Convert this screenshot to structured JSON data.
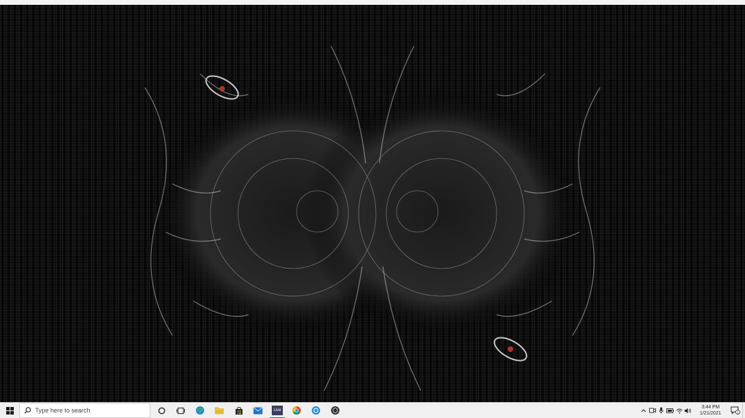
{
  "desktop": {
    "wallpaper_icon": "abstract-wallpaper",
    "colors": {
      "background": "#000000",
      "taskbar": "#f0f0f0",
      "accent": "#0078d7"
    }
  },
  "taskbar": {
    "start_icon": "windows-logo-icon",
    "search": {
      "placeholder": "Type here to search",
      "icon": "search-icon"
    },
    "pinned": [
      {
        "name": "cortana",
        "icon": "circle-icon",
        "active": false
      },
      {
        "name": "task-view",
        "icon": "task-view-icon",
        "active": false
      },
      {
        "name": "edge",
        "icon": "edge-icon",
        "active": false
      },
      {
        "name": "file-explorer",
        "icon": "folder-icon",
        "active": false
      },
      {
        "name": "store",
        "icon": "store-bag-icon",
        "active": false
      },
      {
        "name": "mail",
        "icon": "mail-icon",
        "active": false
      },
      {
        "name": "live",
        "icon": "live-app-icon",
        "label": "Live",
        "active": true
      },
      {
        "name": "chrome",
        "icon": "chrome-icon",
        "active": false
      },
      {
        "name": "app-blue",
        "icon": "blue-circle-app-icon",
        "active": false
      },
      {
        "name": "app-dark",
        "icon": "dark-circle-app-icon",
        "active": false
      }
    ],
    "tray": {
      "icons": [
        "chevron-up-icon",
        "meet-now-icon",
        "microphone-icon",
        "battery-icon",
        "network-icon",
        "volume-icon"
      ],
      "time": "3:44 PM",
      "date": "1/21/2021",
      "notification_icon": "notification-icon",
      "notification_count": "1"
    }
  }
}
